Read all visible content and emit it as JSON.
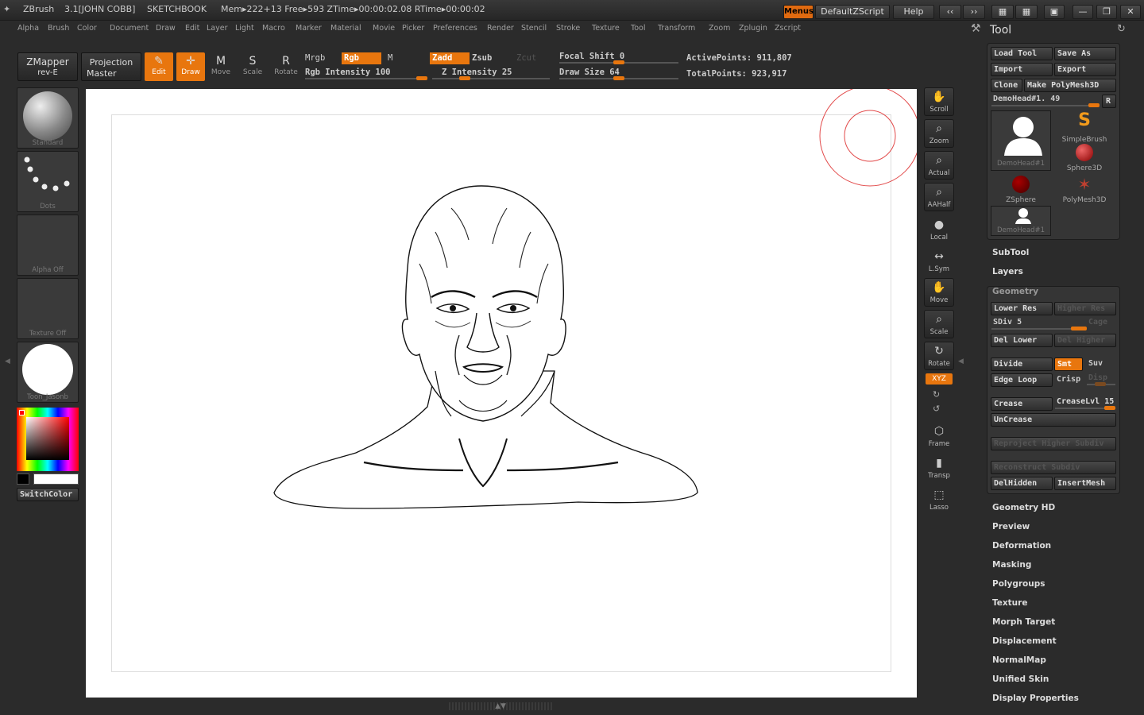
{
  "titlebar": {
    "app": "ZBrush",
    "version": "3.1[JOHN COBB]",
    "doc": "SKETCHBOOK",
    "stats": "Mem▸222+13 Free▸593 ZTime▸00:00:02.08 RTime▸00:00:02",
    "menus_btn": "Menus",
    "script_btn": "DefaultZScript",
    "help_btn": "Help"
  },
  "menubar": {
    "items": [
      "Alpha",
      "Brush",
      "Color",
      "Document",
      "Draw",
      "Edit",
      "Layer",
      "Light",
      "Macro",
      "Marker",
      "Material",
      "Movie",
      "Picker",
      "Preferences",
      "Render",
      "Stencil",
      "Stroke",
      "Texture",
      "Tool",
      "Transform",
      "Zoom",
      "Zplugin",
      "Zscript"
    ]
  },
  "toprow": {
    "zmapper": "ZMapper",
    "zmapper_sub": "rev-E",
    "projection": "Projection",
    "projection_sub": "Master",
    "edit": "Edit",
    "draw": "Draw",
    "move": "Move",
    "scale": "Scale",
    "rotate": "Rotate",
    "mrgb": "Mrgb",
    "rgb": "Rgb",
    "m": "M",
    "rgb_intensity": "Rgb Intensity 100",
    "zadd": "Zadd",
    "zsub": "Zsub",
    "zcut": "Zcut",
    "z_intensity": "Z Intensity 25",
    "focal_shift": "Focal Shift 0",
    "draw_size": "Draw Size 64",
    "active_points": "ActivePoints: 911,807",
    "total_points": "TotalPoints: 923,917"
  },
  "leftshelf": {
    "brush": "Standard",
    "stroke": "Dots",
    "alpha": "Alpha Off",
    "texture": "Texture Off",
    "material": "Toon_Jasonb",
    "switchcolor": "SwitchColor"
  },
  "rightshelf": {
    "buttons": [
      "Scroll",
      "Zoom",
      "Actual",
      "AAHalf",
      "Local",
      "L.Sym",
      "Move",
      "Scale",
      "Rotate",
      "XYZ",
      "Frame",
      "Transp",
      "Lasso"
    ]
  },
  "toolpanel": {
    "title": "Tool",
    "load_tool": "Load Tool",
    "save_as": "Save As",
    "import": "Import",
    "export": "Export",
    "clone": "Clone",
    "make_polymesh": "Make PolyMesh3D",
    "current_tool": "DemoHead#1. 49",
    "r": "R",
    "tools": [
      "DemoHead#1",
      "SimpleBrush",
      "Sphere3D",
      "ZSphere",
      "PolyMesh3D",
      "DemoHead#1"
    ],
    "subtool": "SubTool",
    "layers": "Layers",
    "geometry": "Geometry",
    "lower_res": "Lower Res",
    "higher_res": "Higher Res",
    "sdiv": "SDiv 5",
    "cage": "Cage",
    "del_lower": "Del Lower",
    "del_higher": "Del Higher",
    "divide": "Divide",
    "smt": "Smt",
    "suv": "Suv",
    "edge_loop": "Edge Loop",
    "crisp": "Crisp",
    "disp": "Disp",
    "crease": "Crease",
    "creaselvl": "CreaseLvl 15",
    "uncrease": "UnCrease",
    "reproject": "Reproject Higher Subdiv",
    "reconstruct": "Reconstruct Subdiv",
    "delhidden": "DelHidden",
    "insertmesh": "InsertMesh",
    "sections": [
      "Geometry HD",
      "Preview",
      "Deformation",
      "Masking",
      "Polygroups",
      "Texture",
      "Morph Target",
      "Displacement",
      "NormalMap",
      "Unified Skin",
      "Display Properties"
    ]
  }
}
